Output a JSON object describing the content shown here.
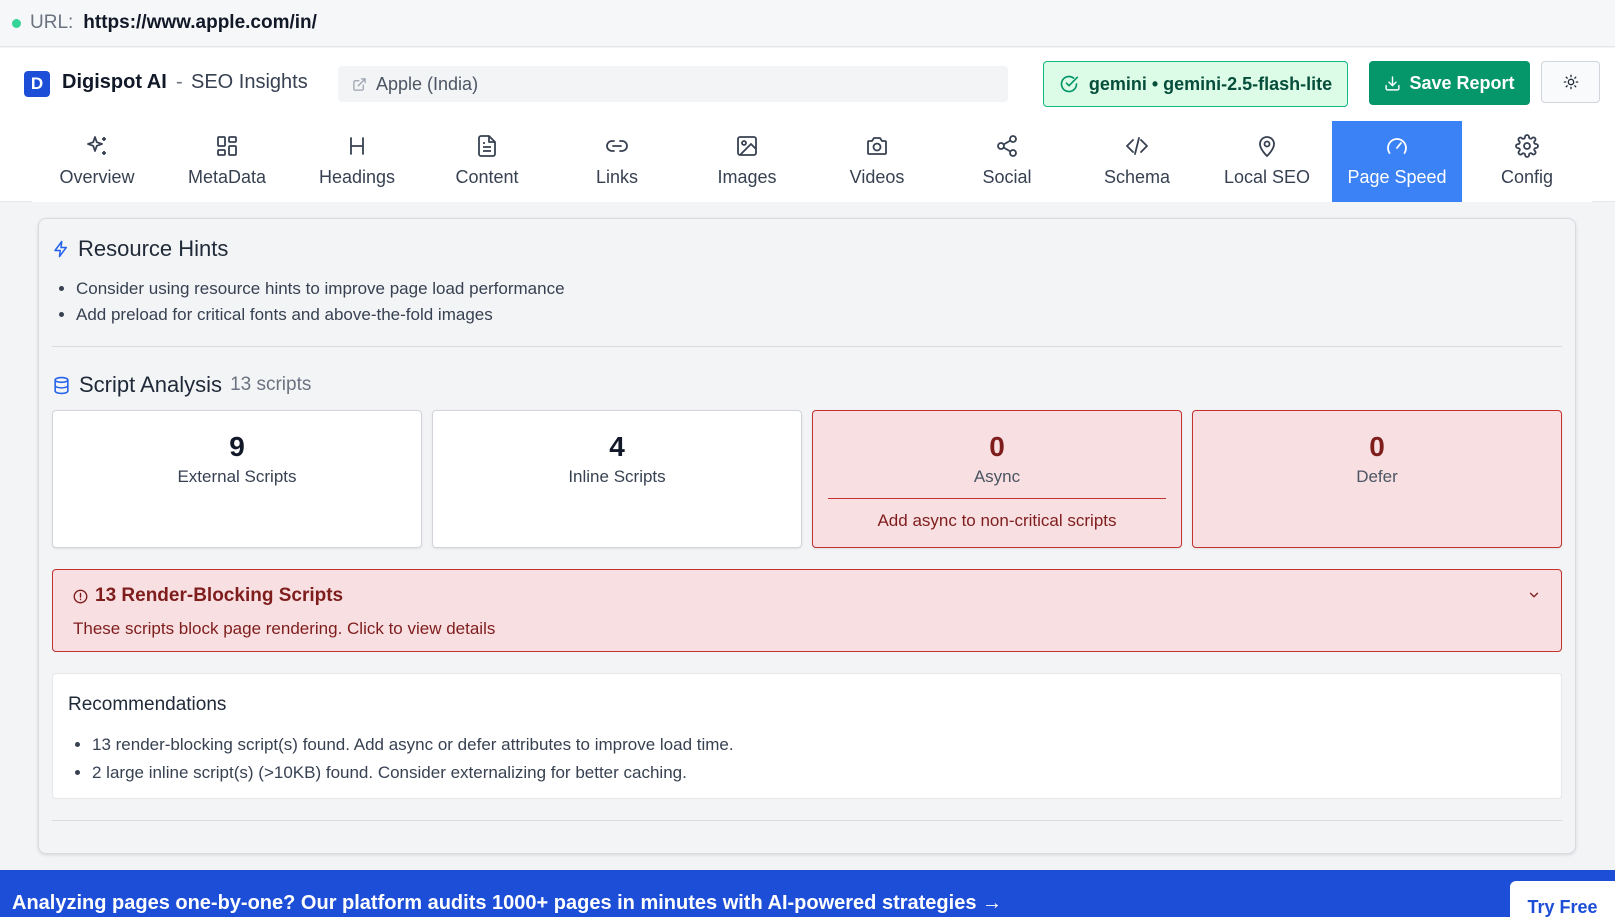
{
  "urlbar": {
    "label": "URL:",
    "url": "https://www.apple.com/in/"
  },
  "header": {
    "logo_letter": "D",
    "brand": "Digispot AI",
    "separator": "-",
    "subtitle": "SEO Insights",
    "site_name": "Apple (India)",
    "model_status": "gemini • gemini-2.5-flash-lite",
    "save_label": "Save Report"
  },
  "tabs": [
    {
      "label": "Overview",
      "icon": "sparkles-icon"
    },
    {
      "label": "MetaData",
      "icon": "grid-icon"
    },
    {
      "label": "Headings",
      "icon": "heading-icon"
    },
    {
      "label": "Content",
      "icon": "document-icon"
    },
    {
      "label": "Links",
      "icon": "link-icon"
    },
    {
      "label": "Images",
      "icon": "image-icon"
    },
    {
      "label": "Videos",
      "icon": "camera-icon"
    },
    {
      "label": "Social",
      "icon": "share-icon"
    },
    {
      "label": "Schema",
      "icon": "code-icon"
    },
    {
      "label": "Local SEO",
      "icon": "map-pin-icon"
    },
    {
      "label": "Page Speed",
      "icon": "gauge-icon",
      "active": true
    },
    {
      "label": "Config",
      "icon": "gear-icon"
    }
  ],
  "resource_hints": {
    "title": "Resource Hints",
    "items": [
      "Consider using resource hints to improve page load performance",
      "Add preload for critical fonts and above-the-fold images"
    ]
  },
  "script_analysis": {
    "title": "Script Analysis",
    "count_label": "13 scripts",
    "stats": [
      {
        "value": "9",
        "label": "External Scripts"
      },
      {
        "value": "4",
        "label": "Inline Scripts"
      },
      {
        "value": "0",
        "label": "Async",
        "tip": "Add async to non-critical scripts"
      },
      {
        "value": "0",
        "label": "Defer"
      }
    ]
  },
  "render_blocking": {
    "title": "13 Render-Blocking Scripts",
    "description": "These scripts block page rendering. Click to view details"
  },
  "recommendations": {
    "title": "Recommendations",
    "items": [
      "13 render-blocking script(s) found. Add async or defer attributes to improve load time.",
      "2 large inline script(s) (>10KB) found. Consider externalizing for better caching."
    ]
  },
  "promo": {
    "text": "Analyzing pages one-by-one? Our platform audits 1000+ pages in minutes with AI-powered strategies →",
    "button": "Try Free"
  },
  "colors": {
    "brand_blue": "#1d4ed8",
    "active_tab": "#3b82f6",
    "save_green": "#059669",
    "alert_red": "#c53030",
    "alert_bg": "#f8dfe1"
  }
}
